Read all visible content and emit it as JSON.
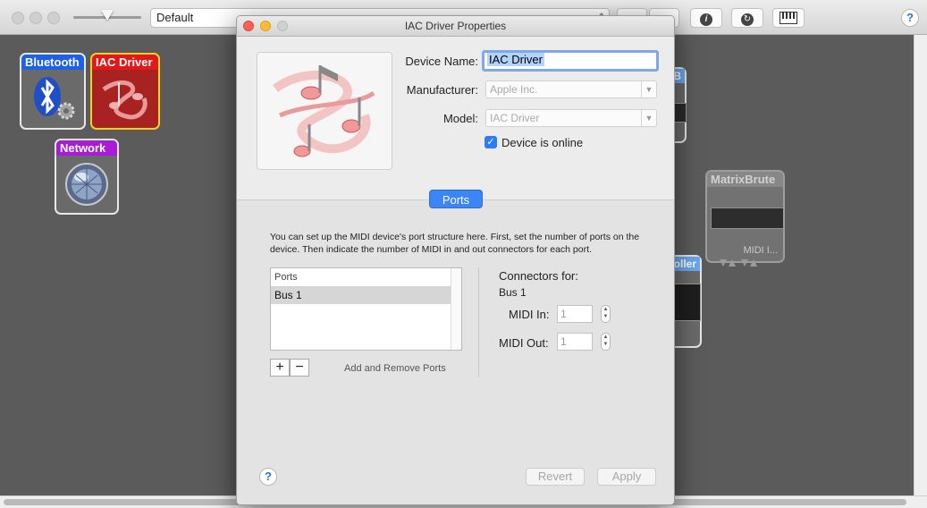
{
  "toolbar": {
    "configuration": "Default",
    "add_label": "+",
    "remove_label": "−",
    "help_label": "?"
  },
  "devices": {
    "bluetooth": "Bluetooth",
    "iac": "IAC Driver",
    "network": "Network",
    "matrixbrute": "MatrixBrute",
    "matrixbrute_sub": "MIDI I...",
    "partial_top": "B",
    "partial_mid": "oller"
  },
  "dialog": {
    "title": "IAC Driver Properties",
    "labels": {
      "device_name": "Device Name:",
      "manufacturer": "Manufacturer:",
      "model": "Model:"
    },
    "device_name": "IAC Driver",
    "manufacturer_placeholder": "Apple Inc.",
    "model_placeholder": "IAC Driver",
    "online_label": "Device is online",
    "online_checked": true,
    "tab_label": "Ports",
    "description": "You can set up the MIDI device's port structure here. First, set the number of ports on the device. Then indicate the number of MIDI in and out connectors for each port.",
    "ports_table": {
      "header": "Ports",
      "rows": [
        "Bus 1"
      ]
    },
    "add_port_label": "+",
    "remove_port_label": "−",
    "add_remove_caption": "Add and Remove Ports",
    "connectors_for": "Connectors for:",
    "selected_port": "Bus 1",
    "midi_in_label": "MIDI In:",
    "midi_in_value": "1",
    "midi_out_label": "MIDI Out:",
    "midi_out_value": "1",
    "help_label": "?",
    "revert_label": "Revert",
    "apply_label": "Apply"
  },
  "colors": {
    "accent": "#3b86f7",
    "bluetooth": "#1d61e8",
    "iac": "#e11919",
    "network": "#a81cd8"
  }
}
